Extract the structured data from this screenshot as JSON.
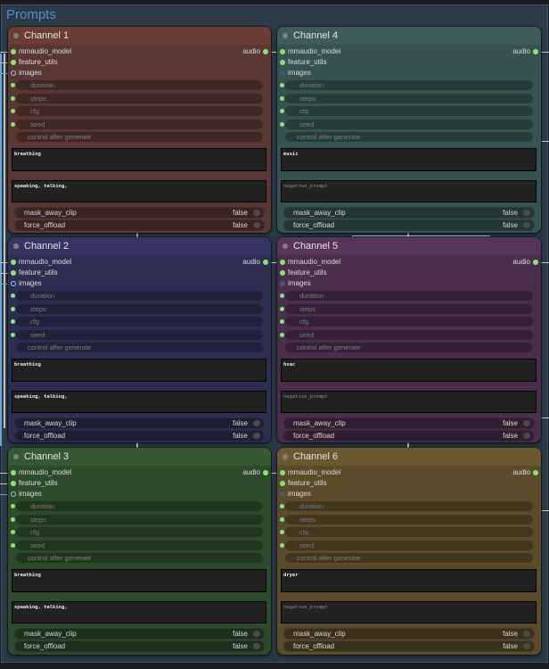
{
  "group": {
    "title": "Prompts"
  },
  "labels": {
    "inputs": [
      "mmaudio_model",
      "feature_utils",
      "images"
    ],
    "output": "audio",
    "widgets": [
      "duration",
      "steps",
      "cfg",
      "seed"
    ],
    "control": "control after generate",
    "toggles": [
      {
        "label": "mask_away_clip",
        "value": "false"
      },
      {
        "label": "force_offload",
        "value": "false"
      }
    ]
  },
  "nodes": [
    {
      "title": "Channel 1",
      "prompt": "breathing",
      "negative": "speaking, talking,",
      "negative_placeholder": "negative_prompt",
      "color_body": "#5a3732",
      "color_head": "#6b3d37"
    },
    {
      "title": "Channel 4",
      "prompt": "music",
      "negative": "",
      "negative_placeholder": "negative_prompt",
      "color_body": "#365252",
      "color_head": "#3e5b5c"
    },
    {
      "title": "Channel 2",
      "prompt": "breathing",
      "negative": "speaking, talking,",
      "negative_placeholder": "negative_prompt",
      "color_body": "#2e2e52",
      "color_head": "#353563"
    },
    {
      "title": "Channel 5",
      "prompt": "hvac",
      "negative": "",
      "negative_placeholder": "negative_prompt",
      "color_body": "#4a2e4c",
      "color_head": "#57355a"
    },
    {
      "title": "Channel 3",
      "prompt": "breathing",
      "negative": "speaking, talking,",
      "negative_placeholder": "negative_prompt",
      "color_body": "#2e4a2c",
      "color_head": "#355a33"
    },
    {
      "title": "Channel 6",
      "prompt": "dryer",
      "negative": "",
      "negative_placeholder": "negative_prompt",
      "color_body": "#5b4b2a",
      "color_head": "#6b5831"
    }
  ]
}
